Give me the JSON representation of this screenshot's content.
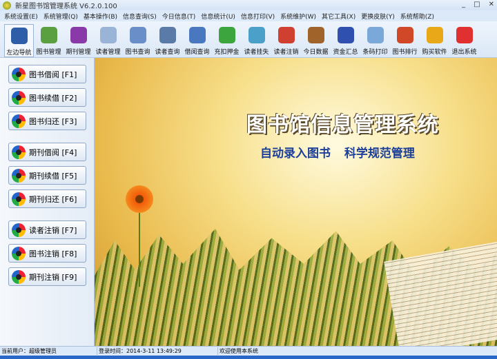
{
  "window": {
    "title": "新星图书馆管理系统 V6.2.0.100",
    "min": "_",
    "max": "□",
    "close": "✕"
  },
  "menu": [
    "系统设置(E)",
    "系统管理(Q)",
    "基本操作(B)",
    "信息查询(S)",
    "今日信息(T)",
    "信息统计(U)",
    "信息打印(V)",
    "系统维护(W)",
    "其它工具(X)",
    "更换皮肤(Y)",
    "系统帮助(Z)"
  ],
  "toolbar": [
    {
      "label": "左边导航",
      "color": "#2f5ea8"
    },
    {
      "label": "图书管理",
      "color": "#5aa040"
    },
    {
      "label": "期刊管理",
      "color": "#8a3aa8"
    },
    {
      "label": "读者管理",
      "color": "#9ab4d8"
    },
    {
      "label": "图书查询",
      "color": "#6a8fc8"
    },
    {
      "label": "读者查询",
      "color": "#5a7aa8"
    },
    {
      "label": "借阅查询",
      "color": "#4a78c0"
    },
    {
      "label": "充扣押金",
      "color": "#3da53d"
    },
    {
      "label": "读者挂失",
      "color": "#4aa0c8"
    },
    {
      "label": "读者注销",
      "color": "#d04030"
    },
    {
      "label": "今日数据",
      "color": "#a0642a"
    },
    {
      "label": "资金汇总",
      "color": "#3050b0"
    },
    {
      "label": "条码打印",
      "color": "#7aa8d8"
    },
    {
      "label": "图书排行",
      "color": "#d04828"
    },
    {
      "label": "购买软件",
      "color": "#e8a818"
    },
    {
      "label": "退出系统",
      "color": "#e03030"
    }
  ],
  "nav": [
    "图书借阅 [F1]",
    "图书续借 [F2]",
    "图书归还 [F3]",
    "期刊借阅 [F4]",
    "期刊续借 [F5]",
    "期刊归还 [F6]",
    "读者注销 [F7]",
    "图书注销 [F8]",
    "期刊注销 [F9]"
  ],
  "banner": {
    "title": "图书馆信息管理系统",
    "subtitle": "自动录入图书 科学规范管理"
  },
  "status": {
    "user": "当前用户：超级管理员",
    "login": "登录时间：2014-3-11 13:49:29",
    "welcome": "欢迎使用本系统"
  }
}
